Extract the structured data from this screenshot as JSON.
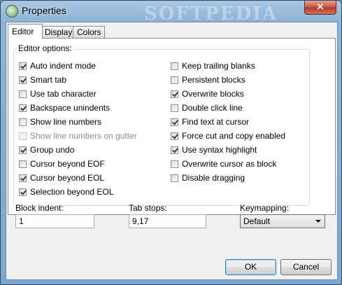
{
  "window": {
    "title": "Properties",
    "close_glyph": "✕",
    "icon": "app-icon",
    "watermark": "SOFTPEDIA"
  },
  "tabs": [
    {
      "label": "Editor",
      "active": true
    },
    {
      "label": "Display",
      "active": false
    },
    {
      "label": "Colors",
      "active": false
    }
  ],
  "editor_options": {
    "group_label": "Editor options:",
    "left": [
      {
        "label": "Auto indent mode",
        "checked": true,
        "enabled": true
      },
      {
        "label": "Smart tab",
        "checked": true,
        "enabled": true
      },
      {
        "label": "Use tab character",
        "checked": false,
        "enabled": true
      },
      {
        "label": "Backspace unindents",
        "checked": true,
        "enabled": true
      },
      {
        "label": "Show line numbers",
        "checked": false,
        "enabled": true
      },
      {
        "label": "Show line numbers on gutter",
        "checked": false,
        "enabled": false
      },
      {
        "label": "Group undo",
        "checked": true,
        "enabled": true
      },
      {
        "label": "Cursor beyond EOF",
        "checked": false,
        "enabled": true
      },
      {
        "label": "Cursor beyond EOL",
        "checked": true,
        "enabled": true
      },
      {
        "label": "Selection beyond EOL",
        "checked": true,
        "enabled": true
      }
    ],
    "right": [
      {
        "label": "Keep trailing blanks",
        "checked": false,
        "enabled": true
      },
      {
        "label": "Persistent blocks",
        "checked": false,
        "enabled": true
      },
      {
        "label": "Overwrite blocks",
        "checked": true,
        "enabled": true
      },
      {
        "label": "Double click line",
        "checked": false,
        "enabled": true
      },
      {
        "label": "Find text at cursor",
        "checked": true,
        "enabled": true
      },
      {
        "label": "Force cut and copy enabled",
        "checked": true,
        "enabled": true
      },
      {
        "label": "Use syntax highlight",
        "checked": true,
        "enabled": true
      },
      {
        "label": "Overwrite cursor as block",
        "checked": false,
        "enabled": true
      },
      {
        "label": "Disable dragging",
        "checked": false,
        "enabled": true
      }
    ]
  },
  "fields": {
    "block_indent": {
      "label": "Block indent:",
      "value": "1"
    },
    "tab_stops": {
      "label": "Tab stops:",
      "value": "9,17"
    },
    "keymapping": {
      "label": "Keymapping:",
      "value": "Default"
    }
  },
  "buttons": {
    "ok": "OK",
    "cancel": "Cancel"
  },
  "colors": {
    "titlebar": "#8fb3d6",
    "client": "#f0f0f0",
    "close": "#c7513d"
  }
}
